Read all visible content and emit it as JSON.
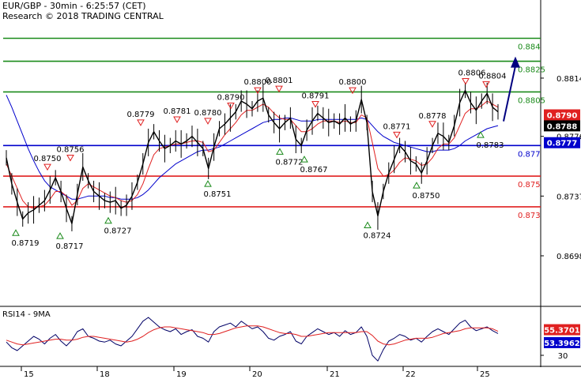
{
  "header": {
    "line1": "EUR/GBP - 30min - 6:25:57 (CET)",
    "line2": "Research © 2018 TRADING CENTRAL"
  },
  "colors": {
    "resistance": "#1a8a1a",
    "pivot": "#0000cc",
    "support": "#e02020",
    "price": "#000000",
    "ma_fast": "#e02020",
    "ma_slow": "#0000cc",
    "arrow": "#000080",
    "tag_red": "#e02020",
    "tag_blue": "#0000cc",
    "tag_black": "#000000"
  },
  "chart_data": {
    "type": "line",
    "title": "EUR/GBP - 30min - 6:25:57 (CET)",
    "y_ticks": [
      "0.8814",
      "0.8776",
      "0.8737",
      "0.8698"
    ],
    "ylim": [
      0.8665,
      0.8865
    ],
    "x_ticks": [
      "15",
      "18",
      "19",
      "20",
      "21",
      "22",
      "25"
    ],
    "levels": [
      {
        "label": "0.884",
        "value": 0.884,
        "role": "resistance"
      },
      {
        "label": "0.8825",
        "value": 0.8825,
        "role": "resistance"
      },
      {
        "label": "0.8805",
        "value": 0.8805,
        "role": "resistance"
      },
      {
        "label": "0.877",
        "value": 0.877,
        "role": "pivot"
      },
      {
        "label": "0.875",
        "value": 0.875,
        "role": "support"
      },
      {
        "label": "0.873",
        "value": 0.873,
        "role": "support"
      }
    ],
    "price_tags": [
      {
        "label": "0.8790",
        "color": "tag_red"
      },
      {
        "label": "0.8788",
        "color": "tag_black"
      },
      {
        "label": "0.8777",
        "color": "tag_blue"
      }
    ],
    "highs": [
      {
        "label": "0.8750",
        "value": 0.875,
        "date": "16"
      },
      {
        "label": "0.8756",
        "value": 0.8756,
        "date": "17"
      },
      {
        "label": "0.8779",
        "value": 0.8779,
        "date": "18"
      },
      {
        "label": "0.8781",
        "value": 0.8781,
        "date": "19"
      },
      {
        "label": "0.8780",
        "value": 0.878,
        "date": "19"
      },
      {
        "label": "0.8790",
        "value": 0.879,
        "date": "19"
      },
      {
        "label": "0.8800",
        "value": 0.88,
        "date": "20"
      },
      {
        "label": "0.8801",
        "value": 0.8801,
        "date": "20"
      },
      {
        "label": "0.8791",
        "value": 0.8791,
        "date": "20"
      },
      {
        "label": "0.8800",
        "value": 0.88,
        "date": "21"
      },
      {
        "label": "0.8771",
        "value": 0.8771,
        "date": "22"
      },
      {
        "label": "0.8778",
        "value": 0.8778,
        "date": "22"
      },
      {
        "label": "0.8806",
        "value": 0.8806,
        "date": "24"
      },
      {
        "label": "0.8804",
        "value": 0.8804,
        "date": "25"
      }
    ],
    "lows": [
      {
        "label": "0.8719",
        "value": 0.8719,
        "date": "15"
      },
      {
        "label": "0.8717",
        "value": 0.8717,
        "date": "17"
      },
      {
        "label": "0.8727",
        "value": 0.8727,
        "date": "18"
      },
      {
        "label": "0.8751",
        "value": 0.8751,
        "date": "19"
      },
      {
        "label": "0.8772",
        "value": 0.8772,
        "date": "20"
      },
      {
        "label": "0.8767",
        "value": 0.8767,
        "date": "20"
      },
      {
        "label": "0.8724",
        "value": 0.8724,
        "date": "21"
      },
      {
        "label": "0.8750",
        "value": 0.875,
        "date": "22"
      },
      {
        "label": "0.8783",
        "value": 0.8783,
        "date": "25"
      }
    ],
    "price_path": [
      0.8762,
      0.8745,
      0.8733,
      0.8722,
      0.8726,
      0.8728,
      0.8731,
      0.8734,
      0.8741,
      0.8749,
      0.874,
      0.8729,
      0.8719,
      0.8738,
      0.8756,
      0.8747,
      0.874,
      0.8737,
      0.8734,
      0.8733,
      0.8734,
      0.8729,
      0.8731,
      0.8737,
      0.8746,
      0.8758,
      0.8772,
      0.8779,
      0.8773,
      0.8768,
      0.877,
      0.8773,
      0.8771,
      0.8773,
      0.8776,
      0.8772,
      0.8768,
      0.8755,
      0.8769,
      0.8781,
      0.8784,
      0.8788,
      0.8792,
      0.8799,
      0.8797,
      0.8794,
      0.8799,
      0.8801,
      0.879,
      0.8785,
      0.8781,
      0.8785,
      0.8788,
      0.8774,
      0.877,
      0.878,
      0.8786,
      0.8791,
      0.8788,
      0.8785,
      0.8786,
      0.8784,
      0.8788,
      0.8784,
      0.8786,
      0.88,
      0.8785,
      0.874,
      0.8724,
      0.874,
      0.8752,
      0.8761,
      0.877,
      0.8766,
      0.876,
      0.8758,
      0.8752,
      0.876,
      0.877,
      0.8778,
      0.8776,
      0.8772,
      0.8783,
      0.8798,
      0.8806,
      0.8798,
      0.8793,
      0.8799,
      0.8804,
      0.8795,
      0.8792
    ],
    "ma_fast": [
      0.8758,
      0.875,
      0.8742,
      0.8734,
      0.873,
      0.8729,
      0.873,
      0.8731,
      0.8735,
      0.874,
      0.874,
      0.8737,
      0.8731,
      0.8734,
      0.8742,
      0.8745,
      0.8743,
      0.8741,
      0.8739,
      0.8737,
      0.8736,
      0.8734,
      0.8733,
      0.8734,
      0.8738,
      0.8745,
      0.8755,
      0.8764,
      0.8768,
      0.8769,
      0.877,
      0.8771,
      0.8771,
      0.8772,
      0.8773,
      0.8773,
      0.8772,
      0.8766,
      0.8767,
      0.8772,
      0.8777,
      0.8781,
      0.8785,
      0.879,
      0.8793,
      0.8793,
      0.8795,
      0.8797,
      0.8795,
      0.8791,
      0.8788,
      0.8787,
      0.8787,
      0.8783,
      0.8779,
      0.8779,
      0.8781,
      0.8784,
      0.8786,
      0.8786,
      0.8786,
      0.8785,
      0.8786,
      0.8785,
      0.8785,
      0.879,
      0.8788,
      0.8772,
      0.8755,
      0.875,
      0.8751,
      0.8754,
      0.8759,
      0.8762,
      0.8761,
      0.876,
      0.8757,
      0.8758,
      0.8762,
      0.8768,
      0.8771,
      0.8771,
      0.8775,
      0.8783,
      0.8791,
      0.8794,
      0.8794,
      0.8796,
      0.8799,
      0.8797,
      0.8795
    ],
    "ma_slow": [
      0.8803,
      0.8795,
      0.8786,
      0.8777,
      0.8768,
      0.876,
      0.8753,
      0.8747,
      0.8743,
      0.8741,
      0.8739,
      0.8737,
      0.8735,
      0.8735,
      0.8736,
      0.8737,
      0.8737,
      0.8737,
      0.8737,
      0.8736,
      0.8736,
      0.8735,
      0.8735,
      0.8735,
      0.8736,
      0.8738,
      0.8741,
      0.8745,
      0.8749,
      0.8752,
      0.8755,
      0.8758,
      0.876,
      0.8762,
      0.8764,
      0.8766,
      0.8767,
      0.8767,
      0.8768,
      0.8769,
      0.8771,
      0.8773,
      0.8775,
      0.8777,
      0.8779,
      0.8781,
      0.8783,
      0.8785,
      0.8786,
      0.8787,
      0.8787,
      0.8788,
      0.8788,
      0.8787,
      0.8786,
      0.8786,
      0.8786,
      0.8787,
      0.8787,
      0.8787,
      0.8787,
      0.8787,
      0.8787,
      0.8787,
      0.8787,
      0.8788,
      0.8787,
      0.8783,
      0.8779,
      0.8776,
      0.8774,
      0.8772,
      0.8771,
      0.877,
      0.8769,
      0.8768,
      0.8767,
      0.8766,
      0.8766,
      0.8767,
      0.8767,
      0.8767,
      0.8768,
      0.877,
      0.8773,
      0.8775,
      0.8777,
      0.8779,
      0.8781,
      0.8782,
      0.8783
    ],
    "forecast_arrow": {
      "from": 0.8792,
      "to": 0.8825
    },
    "rsi": {
      "title": "RSI14 - 9MA",
      "y_ticks": [
        "30"
      ],
      "ylim": [
        20,
        80
      ],
      "tags": [
        {
          "label": "55.3701",
          "color": "tag_red"
        },
        {
          "label": "53.3962",
          "color": "tag_blue"
        }
      ],
      "rsi": [
        44,
        38,
        35,
        40,
        45,
        50,
        47,
        42,
        48,
        52,
        45,
        40,
        46,
        55,
        58,
        50,
        48,
        45,
        44,
        46,
        42,
        40,
        45,
        50,
        58,
        66,
        70,
        65,
        60,
        57,
        55,
        58,
        52,
        55,
        57,
        50,
        48,
        44,
        55,
        60,
        62,
        64,
        60,
        66,
        62,
        58,
        60,
        55,
        48,
        46,
        50,
        52,
        55,
        45,
        42,
        50,
        54,
        58,
        55,
        52,
        54,
        50,
        56,
        52,
        54,
        60,
        50,
        30,
        24,
        36,
        45,
        48,
        52,
        50,
        46,
        48,
        44,
        50,
        55,
        58,
        55,
        52,
        58,
        64,
        67,
        60,
        56,
        58,
        60,
        56,
        53
      ],
      "ma": [
        46,
        44,
        42,
        41,
        42,
        43,
        44,
        45,
        46,
        47,
        47,
        46,
        46,
        47,
        49,
        50,
        50,
        49,
        48,
        47,
        46,
        45,
        44,
        45,
        47,
        50,
        54,
        57,
        59,
        60,
        60,
        59,
        58,
        57,
        56,
        55,
        54,
        52,
        52,
        53,
        55,
        57,
        59,
        60,
        61,
        61,
        61,
        60,
        58,
        56,
        54,
        53,
        53,
        52,
        50,
        50,
        51,
        52,
        53,
        54,
        54,
        54,
        54,
        54,
        54,
        55,
        55,
        51,
        45,
        42,
        41,
        42,
        44,
        46,
        47,
        48,
        48,
        48,
        49,
        51,
        53,
        54,
        55,
        56,
        58,
        59,
        59,
        59,
        59,
        58,
        55.37
      ]
    }
  }
}
